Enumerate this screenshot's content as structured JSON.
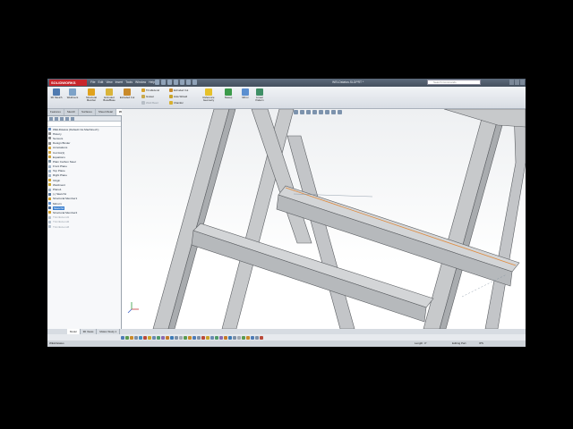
{
  "app": {
    "logo_text": "SOLIDWORKS",
    "menu": [
      "File",
      "Edit",
      "View",
      "Insert",
      "Tools",
      "Window",
      "Help"
    ],
    "doc_title": "WELDstatus.SLDPRT *",
    "search_placeholder": "Search Commands"
  },
  "ribbon": {
    "buttons": [
      {
        "label": "3D Sketch",
        "color": "#4f7ab0"
      },
      {
        "label": "Weldment",
        "color": "#7da2c8"
      },
      {
        "label": "Structural Member",
        "color": "#e0a21d"
      },
      {
        "label": "Extruded Boss/Base",
        "color": "#d9b43a"
      },
      {
        "label": "Extruded Cut",
        "color": "#c98a2a"
      }
    ],
    "small_col1": [
      "Trim/Extend",
      "Gusset",
      "Weld Bead"
    ],
    "small_col2": [
      "Extruded Cut",
      "Hole Wizard",
      "Chamfer"
    ],
    "buttons2": [
      {
        "label": "Reference Geometry",
        "color": "#e6c12a"
      },
      {
        "label": "Sweep",
        "color": "#3b9a4a"
      },
      {
        "label": "Mirror",
        "color": "#5b8fd0"
      },
      {
        "label": "Linear Pattern",
        "color": "#3f8f66"
      }
    ]
  },
  "tabs": [
    "Features",
    "Sketch",
    "Surfaces",
    "Sheet Metal",
    "Weldments",
    "Evaluate",
    "DimXpert"
  ],
  "active_tab": "Weldments",
  "tree": [
    {
      "label": "WELDstatus  (Default<As Machined>)",
      "color": "#6a8fc0",
      "cls": ""
    },
    {
      "label": "History",
      "color": "#8a8a8a",
      "cls": ""
    },
    {
      "label": "Sensors",
      "color": "#8a8a8a",
      "cls": ""
    },
    {
      "label": "Design Binder",
      "color": "#8a8a8a",
      "cls": ""
    },
    {
      "label": "Annotations",
      "color": "#d2a43b",
      "cls": ""
    },
    {
      "label": "Cut list(1)",
      "color": "#d2a43b",
      "cls": ""
    },
    {
      "label": "Equations",
      "color": "#d2a43b",
      "cls": ""
    },
    {
      "label": "Plain Carbon Steel",
      "color": "#7a8fa0",
      "cls": ""
    },
    {
      "label": "Front Plane",
      "color": "#9fb3c9",
      "cls": ""
    },
    {
      "label": "Top Plane",
      "color": "#9fb3c9",
      "cls": ""
    },
    {
      "label": "Right Plane",
      "color": "#9fb3c9",
      "cls": ""
    },
    {
      "label": "Origin",
      "color": "#d0a030",
      "cls": ""
    },
    {
      "label": "Weldment",
      "color": "#c9a42a",
      "cls": ""
    },
    {
      "label": "Plane1",
      "color": "#9fb3c9",
      "cls": ""
    },
    {
      "label": "(-) Sketch1",
      "color": "#4e6f99",
      "cls": ""
    },
    {
      "label": "Structural Member1",
      "color": "#d19d28",
      "cls": ""
    },
    {
      "label": "Mirror1",
      "color": "#5b8fd0",
      "cls": ""
    },
    {
      "label": "Sketch2",
      "color": "#4e6f99",
      "cls": "sel"
    },
    {
      "label": "Structural Member2",
      "color": "#d19d28",
      "cls": ""
    },
    {
      "label": "Trim/Extend1",
      "color": "#b7c3cf",
      "cls": "grey"
    },
    {
      "label": "Trim/Extend2",
      "color": "#b7c3cf",
      "cls": "grey"
    },
    {
      "label": "Trim/Extend3",
      "color": "#b7c3cf",
      "cls": "grey"
    }
  ],
  "bottom_tabs": [
    "Model",
    "3D Views",
    "Motion Study 1"
  ],
  "status": {
    "left": "WELDstatus",
    "length": "Length: 4\"",
    "mode": "Editing Part",
    "units": "IPS"
  },
  "colors": {
    "beam_face": "#c7c9cb",
    "beam_side": "#a9acaf",
    "beam_edge": "#5b5e62",
    "highlight": "#e08a3c",
    "accent": "#3a7fd0"
  }
}
